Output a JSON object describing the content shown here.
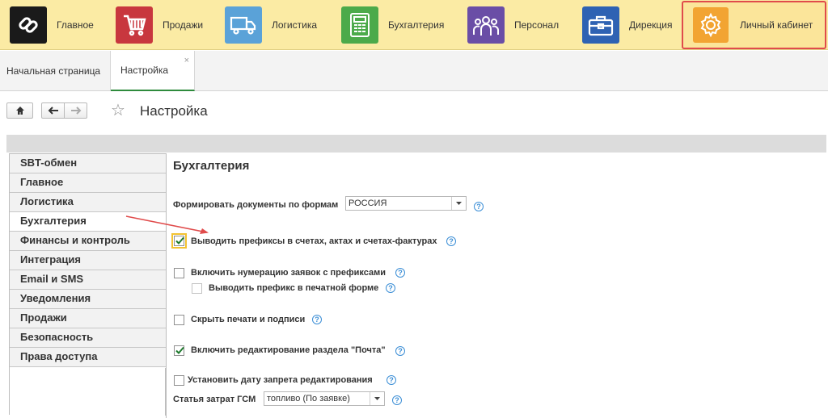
{
  "sections": [
    {
      "label": "Главное",
      "icon": "main-logo-icon",
      "color": "#1a1a1a"
    },
    {
      "label": "Продажи",
      "icon": "cart-icon",
      "color": "#c8373e"
    },
    {
      "label": "Логистика",
      "icon": "truck-icon",
      "color": "#5aa2d8"
    },
    {
      "label": "Бухгалтерия",
      "icon": "calculator-icon",
      "color": "#4caa4a"
    },
    {
      "label": "Персонал",
      "icon": "people-icon",
      "color": "#6a4ea6"
    },
    {
      "label": "Дирекция",
      "icon": "briefcase-icon",
      "color": "#2e62b3"
    },
    {
      "label": "Личный кабинет",
      "icon": "gear-icon",
      "color": "#f2a432"
    }
  ],
  "tabs": [
    {
      "label": "Начальная страница"
    },
    {
      "label": "Настройка",
      "close": "×"
    }
  ],
  "toolbar": {
    "title": "Настройка",
    "favorite_icon": "star-icon"
  },
  "menu": [
    {
      "label": "SBT-обмен"
    },
    {
      "label": "Главное"
    },
    {
      "label": "Логистика"
    },
    {
      "label": "Бухгалтерия",
      "active": true
    },
    {
      "label": "Финансы и контроль"
    },
    {
      "label": "Интеграция"
    },
    {
      "label": "Email и SMS"
    },
    {
      "label": "Уведомления"
    },
    {
      "label": "Продажи"
    },
    {
      "label": "Безопасность"
    },
    {
      "label": "Права доступа"
    }
  ],
  "content": {
    "title": "Бухгалтерия",
    "form_label": "Формировать документы по формам",
    "form_value": "РОССИЯ",
    "help": "?",
    "options": [
      {
        "label": "Выводить префиксы в счетах, актах и счетах-фактурах",
        "checked": true
      },
      {
        "label": "Включить нумерацию заявок с префиксами",
        "checked": false
      },
      {
        "label": "Выводить префикс в печатной форме",
        "checked": false,
        "disabled": true
      },
      {
        "label": "Скрыть печати и подписи",
        "checked": false
      },
      {
        "label": "Включить редактирование раздела \"Почта\"",
        "checked": true
      },
      {
        "label": "Установить дату запрета редактирования",
        "checked": false
      }
    ],
    "fuel_label": "Статья затрат ГСМ",
    "fuel_value": "топливо (По заявке)"
  },
  "colors": {
    "accent_green": "#2e8b3c",
    "highlight_red": "#e04b4b",
    "topbar": "#fbeba4",
    "help_blue": "#3b8ed6"
  }
}
